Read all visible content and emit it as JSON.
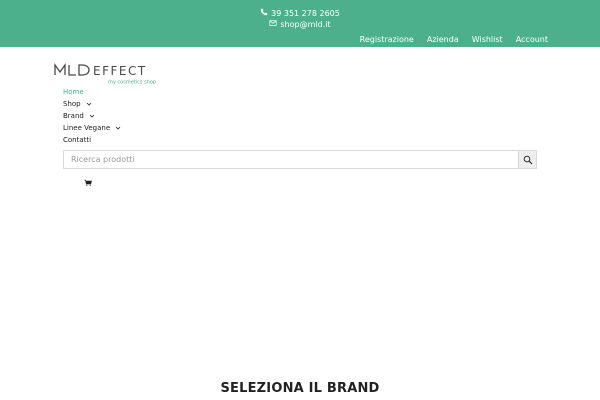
{
  "topbar": {
    "phone": "39 351 278 2605",
    "email": "shop@mld.it",
    "nav": [
      "Registrazione",
      "Azienda",
      "Wishlist",
      "Account"
    ]
  },
  "logo": {
    "wordmark": "MLD EFFECT",
    "tagline": "my cosmetics shop"
  },
  "menu": {
    "items": [
      {
        "label": "Home",
        "has_dropdown": false,
        "active": true
      },
      {
        "label": "Shop",
        "has_dropdown": true,
        "active": false
      },
      {
        "label": "Brand",
        "has_dropdown": true,
        "active": false
      },
      {
        "label": "Linee Vegane",
        "has_dropdown": true,
        "active": false
      },
      {
        "label": "Contatti",
        "has_dropdown": false,
        "active": false
      }
    ]
  },
  "search": {
    "placeholder": "Ricerca prodotti",
    "value": ""
  },
  "section": {
    "title": "SELEZIONA IL BRAND"
  },
  "colors": {
    "accent": "#4cb08c",
    "text": "#222222"
  },
  "icons": [
    "phone-icon",
    "mail-icon",
    "chevron-down-icon",
    "search-icon",
    "cart-icon"
  ]
}
